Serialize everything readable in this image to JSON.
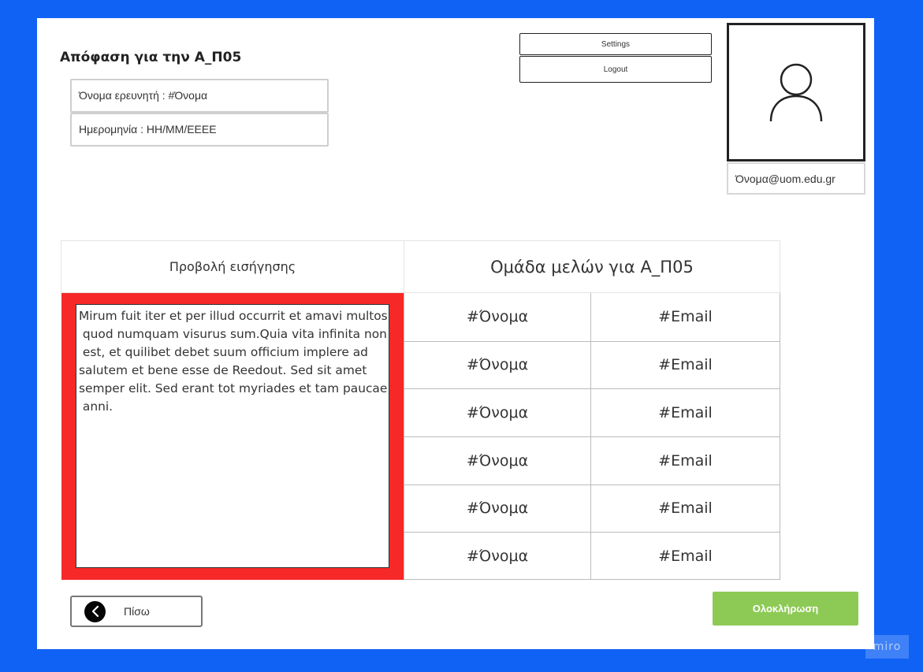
{
  "header": {
    "title": "Απόφαση για την Α_Π05",
    "researcher_field": "Όνομα ερευνητή : #Όνομα",
    "date_field": "Ημερομηνία : ΗΗ/ΜΜ/ΕΕΕΕ"
  },
  "top_buttons": {
    "settings_label": "Settings",
    "logout_label": "Logout"
  },
  "profile": {
    "avatar_icon": "user-icon",
    "email": "Όνομα@uom.edu.gr"
  },
  "proposal": {
    "header": "Προβολή εισήγησης",
    "text": "Mirum fuit iter et per illud occurrit et amavi multos\n quod numquam visurus sum.Quia vita infinita non\n est, et quilibet debet suum officium implere ad\nsalutem et bene esse de Reedout. Sed sit amet\nsemper elit. Sed erant tot myriades et tam paucae\n anni."
  },
  "members": {
    "header": "Ομάδα μελών για Α_Π05",
    "rows": [
      {
        "name": "#Όνομα",
        "email": "#Email"
      },
      {
        "name": "#Όνομα",
        "email": "#Email"
      },
      {
        "name": "#Όνομα",
        "email": "#Email"
      },
      {
        "name": "#Όνομα",
        "email": "#Email"
      },
      {
        "name": "#Όνομα",
        "email": "#Email"
      },
      {
        "name": "#Όνομα",
        "email": "#Email"
      }
    ]
  },
  "footer": {
    "back_label": "Πίσω",
    "back_icon": "chevron-left-icon",
    "finish_label": "Ολοκλήρωση"
  },
  "colors": {
    "background": "#1062f5",
    "proposal_highlight": "#f62828",
    "finish_button": "#8dca55"
  },
  "watermark": "miro"
}
